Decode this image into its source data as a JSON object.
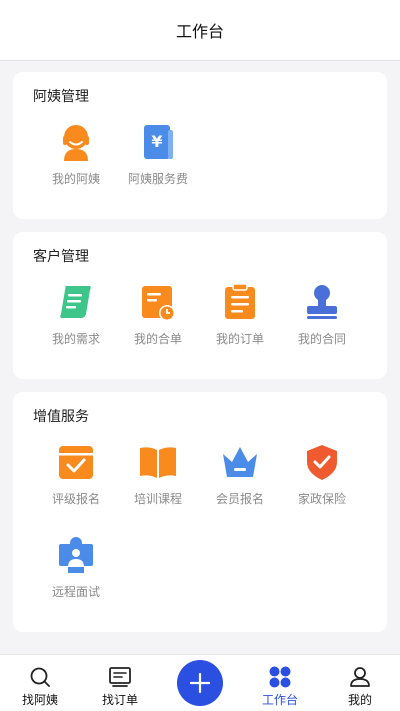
{
  "header": {
    "title": "工作台"
  },
  "sections": {
    "auntie": {
      "title": "阿姨管理",
      "items": [
        {
          "label": "我的阿姨",
          "icon": "auntie-avatar-icon"
        },
        {
          "label": "阿姨服务费",
          "icon": "service-fee-icon"
        }
      ]
    },
    "customer": {
      "title": "客户管理",
      "items": [
        {
          "label": "我的需求",
          "icon": "requirement-scroll-icon"
        },
        {
          "label": "我的合单",
          "icon": "merged-order-icon"
        },
        {
          "label": "我的订单",
          "icon": "order-clipboard-icon"
        },
        {
          "label": "我的合同",
          "icon": "contract-stamp-icon"
        }
      ]
    },
    "value": {
      "title": "增值服务",
      "items": [
        {
          "label": "评级报名",
          "icon": "rating-checkbox-icon"
        },
        {
          "label": "培训课程",
          "icon": "training-book-icon"
        },
        {
          "label": "会员报名",
          "icon": "member-crown-icon"
        },
        {
          "label": "家政保险",
          "icon": "insurance-shield-icon"
        },
        {
          "label": "远程面试",
          "icon": "remote-interview-icon"
        }
      ]
    }
  },
  "tabbar": {
    "items": [
      {
        "label": "找阿姨",
        "icon": "search-icon"
      },
      {
        "label": "找订单",
        "icon": "order-list-icon"
      },
      {
        "label": "工作台",
        "icon": "dashboard-grid-icon",
        "active": true
      },
      {
        "label": "我的",
        "icon": "user-icon"
      }
    ],
    "fab_icon": "plus-icon"
  },
  "colors": {
    "orange": "#f98a1e",
    "blue": "#4a8ce8",
    "green": "#3dc58a",
    "accent": "#2b4fe0",
    "red": "#f05a2f"
  }
}
